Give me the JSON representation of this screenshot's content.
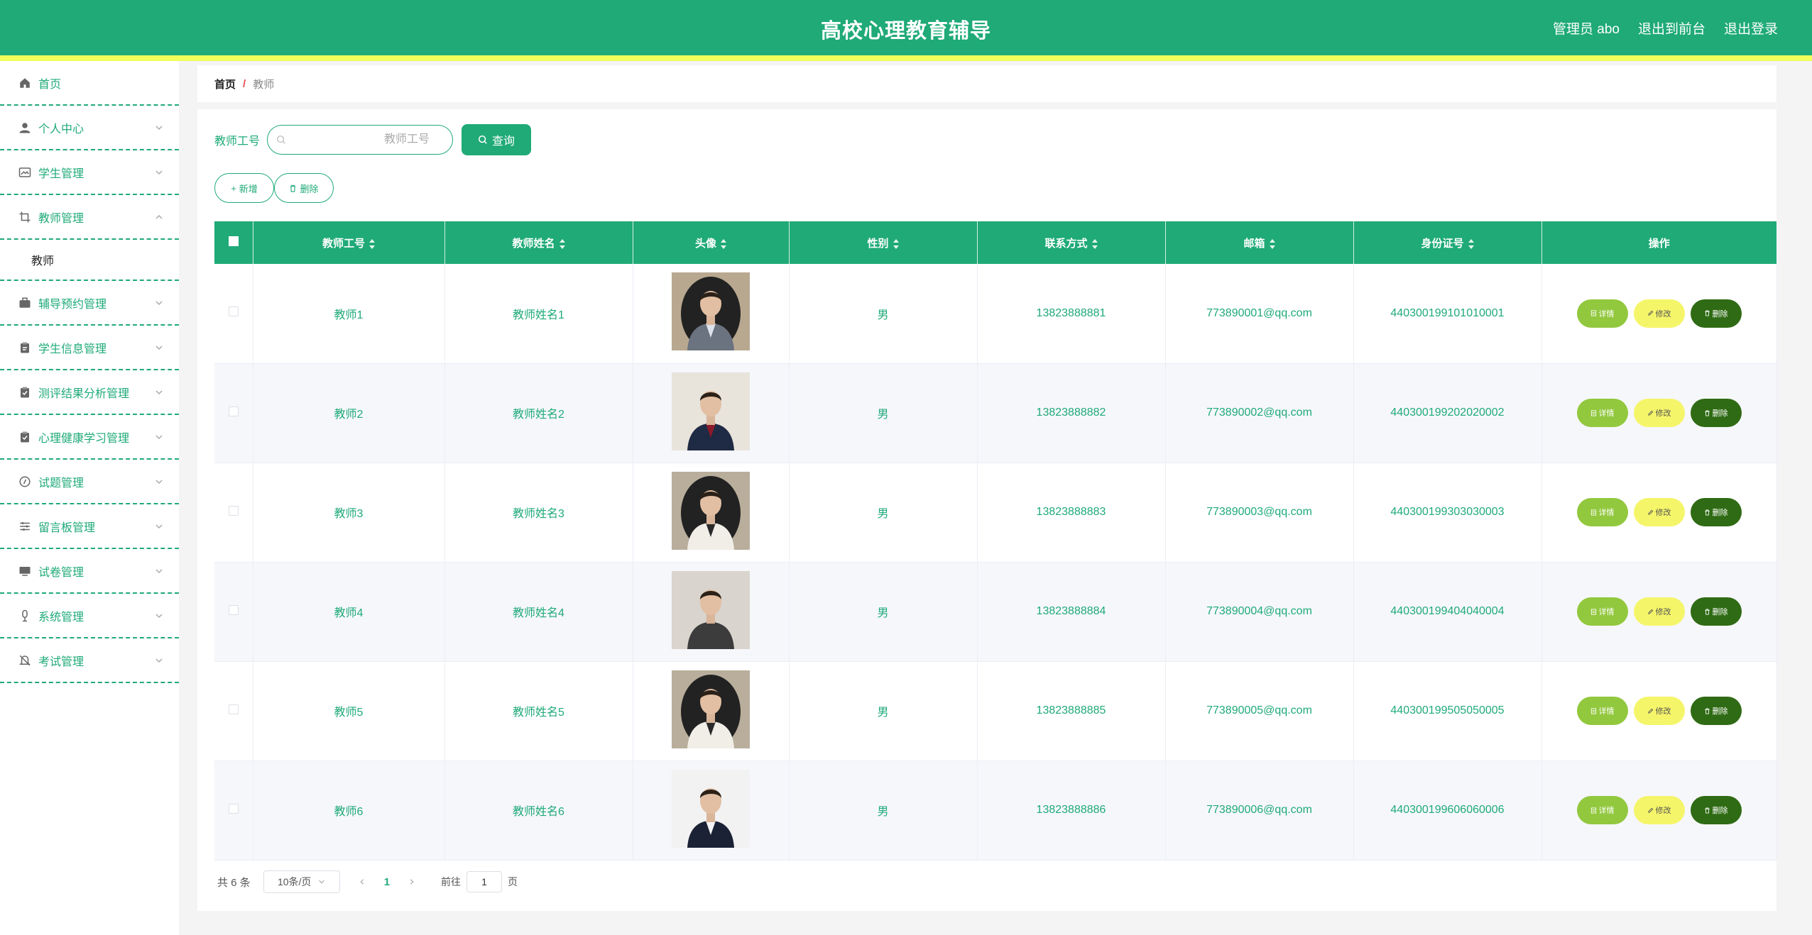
{
  "header": {
    "title": "高校心理教育辅导",
    "admin_label": "管理员 abo",
    "front_label": "退出到前台",
    "logout_label": "退出登录"
  },
  "sidebar": {
    "items": [
      {
        "label": "首页",
        "icon": "home-icon"
      },
      {
        "label": "个人中心",
        "icon": "user-icon"
      },
      {
        "label": "学生管理",
        "icon": "image-icon"
      },
      {
        "label": "教师管理",
        "icon": "crop-icon"
      },
      {
        "label": "辅导预约管理",
        "icon": "briefcase-icon"
      },
      {
        "label": "学生信息管理",
        "icon": "clipboard-icon"
      },
      {
        "label": "测评结果分析管理",
        "icon": "clipboard-check-icon"
      },
      {
        "label": "心理健康学习管理",
        "icon": "clipboard-check-icon"
      },
      {
        "label": "试题管理",
        "icon": "compass-icon"
      },
      {
        "label": "留言板管理",
        "icon": "sliders-icon"
      },
      {
        "label": "试卷管理",
        "icon": "monitor-icon"
      },
      {
        "label": "系统管理",
        "icon": "microphone-icon"
      },
      {
        "label": "考试管理",
        "icon": "bell-off-icon"
      }
    ],
    "sub_item": "教师"
  },
  "breadcrumb": {
    "home": "首页",
    "separator": "/",
    "current": "教师"
  },
  "search": {
    "label": "教师工号",
    "placeholder": "教师工号",
    "button": "查询"
  },
  "actions": {
    "add": "新增",
    "delete": "删除"
  },
  "table": {
    "headers": [
      "教师工号",
      "教师姓名",
      "头像",
      "性别",
      "联系方式",
      "邮箱",
      "身份证号",
      "操作"
    ],
    "rows": [
      {
        "id": "教师1",
        "name": "教师姓名1",
        "gender": "男",
        "phone": "13823888881",
        "email": "773890001@qq.com",
        "idcard": "440300199101010001"
      },
      {
        "id": "教师2",
        "name": "教师姓名2",
        "gender": "男",
        "phone": "13823888882",
        "email": "773890002@qq.com",
        "idcard": "440300199202020002"
      },
      {
        "id": "教师3",
        "name": "教师姓名3",
        "gender": "男",
        "phone": "13823888883",
        "email": "773890003@qq.com",
        "idcard": "440300199303030003"
      },
      {
        "id": "教师4",
        "name": "教师姓名4",
        "gender": "男",
        "phone": "13823888884",
        "email": "773890004@qq.com",
        "idcard": "440300199404040004"
      },
      {
        "id": "教师5",
        "name": "教师姓名5",
        "gender": "男",
        "phone": "13823888885",
        "email": "773890005@qq.com",
        "idcard": "440300199505050005"
      },
      {
        "id": "教师6",
        "name": "教师姓名6",
        "gender": "男",
        "phone": "13823888886",
        "email": "773890006@qq.com",
        "idcard": "440300199606060006"
      }
    ],
    "op_detail": "详情",
    "op_edit": "修改",
    "op_delete": "删除"
  },
  "pagination": {
    "total": "共 6 条",
    "page_size": "10条/页",
    "current_page": "1",
    "goto_prefix": "前往",
    "goto_value": "1",
    "goto_suffix": "页"
  },
  "colors": {
    "primary": "#1faa78",
    "accent_stripe": "#f0ff5a",
    "detail_button": "#92c83e",
    "edit_button": "#f5f56a",
    "delete_button": "#2f6b14"
  }
}
